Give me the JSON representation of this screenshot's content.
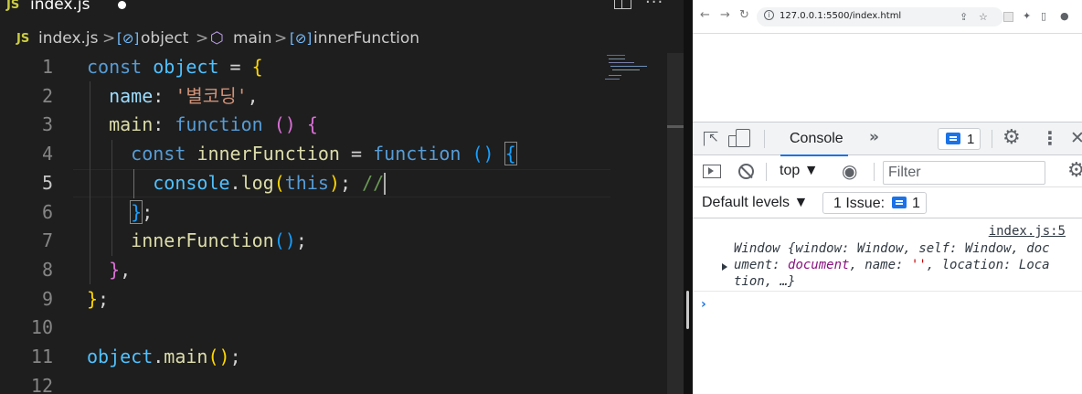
{
  "editor": {
    "tab": {
      "icon_text": "JS",
      "title": "index.js",
      "dirty_icon": "dot-icon"
    },
    "breadcrumb": {
      "file_icon_text": "JS",
      "file": "index.js",
      "sep": ">",
      "items": [
        "object",
        "main",
        "innerFunction"
      ]
    },
    "line_numbers": [
      "1",
      "2",
      "3",
      "4",
      "5",
      "6",
      "7",
      "8",
      "9",
      "10",
      "11",
      "12"
    ],
    "active_line": "5",
    "code": {
      "l1": {
        "kw": "const",
        "name": "object",
        "eq": " = ",
        "brace": "{"
      },
      "l2": {
        "key": "name",
        "colon": ": ",
        "str": "'별코딩'",
        "comma": ","
      },
      "l3": {
        "key": "main",
        "colon": ": ",
        "kw": "function",
        "parens": " () ",
        "brace": "{"
      },
      "l4": {
        "kw": "const",
        "name": "innerFunction",
        "eq": " = ",
        "kw2": "function",
        "parens": " () ",
        "brace": "{"
      },
      "l5": {
        "obj": "console",
        "dot": ".",
        "fn": "log",
        "open": "(",
        "this": "this",
        "close": ")",
        "semi": "; ",
        "comment": "//"
      },
      "l6": {
        "brace": "}",
        "semi": ";"
      },
      "l7": {
        "fn": "innerFunction",
        "parens": "()",
        "semi": ";"
      },
      "l8": {
        "brace": "}",
        "comma": ","
      },
      "l9": {
        "brace": "}",
        "semi": ";"
      },
      "l11": {
        "obj": "object",
        "dot": ".",
        "fn": "main",
        "parens": "()",
        "semi": ";"
      }
    }
  },
  "browser": {
    "url": "127.0.0.1:5500/index.html",
    "nav_icons": [
      "back-icon",
      "forward-icon",
      "reload-icon"
    ]
  },
  "devtools": {
    "active_tab": "Console",
    "more_tabs": "»",
    "messages_badge_count": "1",
    "context": "top ▼",
    "filter_placeholder": "Filter",
    "levels": "Default levels ▼",
    "issues_label": "1 Issue:",
    "issues_count": "1",
    "log": {
      "source": "index.js:5",
      "line1": "Window {window: Window, self: Window, doc",
      "line2_a": "ument: ",
      "line2_b": "document",
      "line2_c": ", name: ",
      "line2_d": "''",
      "line2_e": ", location: Loca",
      "line3": "tion, …}"
    },
    "prompt": "›"
  },
  "colors": {
    "editor_bg": "#1e1e1e",
    "keyword": "#569cd6",
    "variable": "#4fc1ff",
    "property": "#9cdcfe",
    "string": "#ce9178",
    "function": "#dcdcaa",
    "bracket_level1": "#ffd700",
    "bracket_level2": "#da70d6",
    "bracket_level3": "#179fff",
    "comment": "#6a9955",
    "devtools_accent": "#1a73e8"
  }
}
